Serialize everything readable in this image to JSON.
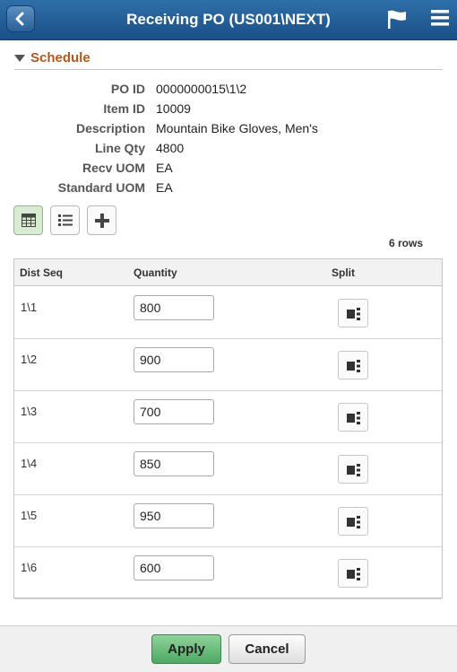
{
  "header": {
    "title": "Receiving PO (US001\\NEXT)",
    "back_icon": "chevron-left-icon",
    "flag_icon": "flag-icon",
    "menu_icon": "hamburger-menu-icon"
  },
  "section": {
    "title": "Schedule"
  },
  "fields": [
    {
      "label": "PO ID",
      "value": "0000000015\\1\\2"
    },
    {
      "label": "Item ID",
      "value": "10009"
    },
    {
      "label": "Description",
      "value": "Mountain Bike Gloves, Men's"
    },
    {
      "label": "Line Qty",
      "value": "4800"
    },
    {
      "label": "Recv UOM",
      "value": "EA"
    },
    {
      "label": "Standard UOM",
      "value": "EA"
    }
  ],
  "grid": {
    "row_count": "6 rows",
    "columns": [
      "Dist Seq",
      "Quantity",
      "Split"
    ],
    "rows": [
      {
        "seq": "1\\1",
        "qty": "800"
      },
      {
        "seq": "1\\2",
        "qty": "900"
      },
      {
        "seq": "1\\3",
        "qty": "700"
      },
      {
        "seq": "1\\4",
        "qty": "850"
      },
      {
        "seq": "1\\5",
        "qty": "950"
      },
      {
        "seq": "1\\6",
        "qty": "600"
      }
    ]
  },
  "footer": {
    "apply_label": "Apply",
    "cancel_label": "Cancel"
  },
  "colors": {
    "header": "#1f5590",
    "section_title": "#b5571c",
    "apply": "#5db76f"
  }
}
